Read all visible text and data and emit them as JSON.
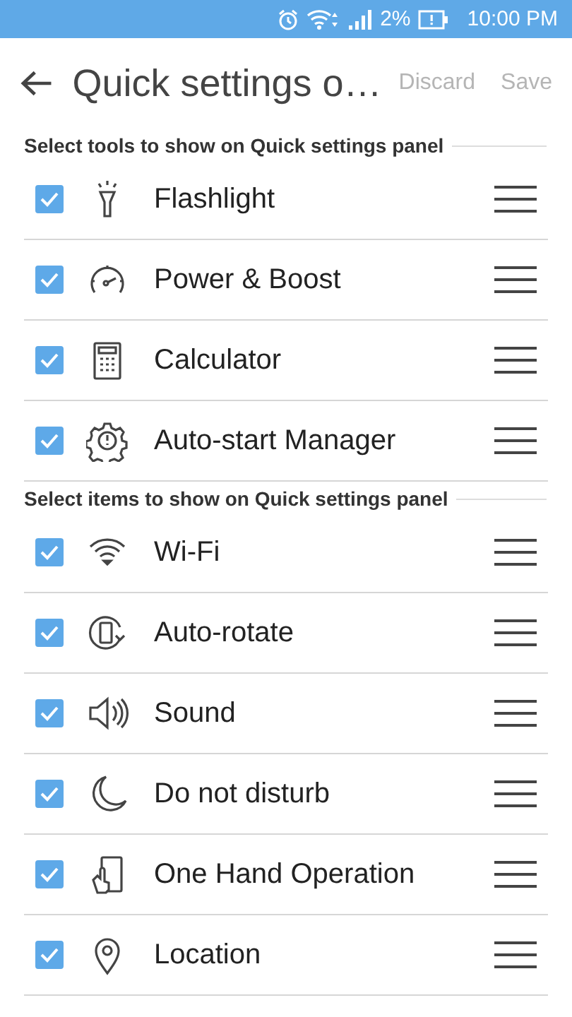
{
  "status_bar": {
    "battery": "2%",
    "time": "10:00 PM"
  },
  "header": {
    "title": "Quick settings o…",
    "actions": [
      {
        "label": "Discard",
        "disabled": true
      },
      {
        "label": "Save",
        "disabled": true
      }
    ]
  },
  "sections": [
    {
      "title": "Select tools to show on Quick settings panel",
      "items": [
        {
          "label": "Flashlight",
          "checked": true
        },
        {
          "label": "Power & Boost",
          "checked": true
        },
        {
          "label": "Calculator",
          "checked": true
        },
        {
          "label": "Auto-start Manager",
          "checked": true
        }
      ]
    },
    {
      "title": "Select items to show on Quick settings panel",
      "items": [
        {
          "label": "Wi-Fi",
          "checked": true
        },
        {
          "label": "Auto-rotate",
          "checked": true
        },
        {
          "label": "Sound",
          "checked": true
        },
        {
          "label": "Do not disturb",
          "checked": true
        },
        {
          "label": "One Hand Operation",
          "checked": true
        },
        {
          "label": "Location",
          "checked": true
        }
      ]
    }
  ]
}
